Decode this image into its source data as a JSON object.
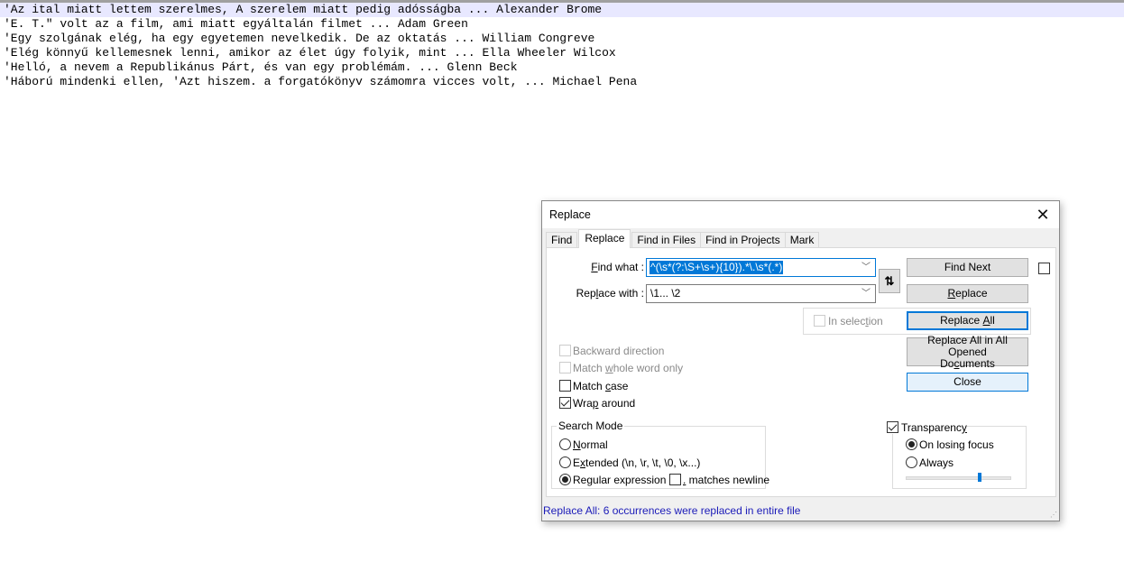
{
  "editor": {
    "lines": [
      "'Az ital miatt lettem szerelmes, A szerelem miatt pedig adósságba ... Alexander Brome",
      "'E. T.\" volt az a film, ami miatt egyáltalán filmet ... Adam Green",
      "'Egy szolgának elég, ha egy egyetemen nevelkedik. De az oktatás ... William Congreve",
      "'Elég könnyű kellemesnek lenni, amikor az élet úgy folyik, mint ... Ella Wheeler Wilcox",
      "'Helló, a nevem a Republikánus Párt, és van egy problémám. ... Glenn Beck",
      "'Háború mindenki ellen, 'Azt hiszem. a forgatókönyv számomra vicces volt, ... Michael Pena"
    ],
    "current_line_color": "#e8e8ff"
  },
  "dialog": {
    "title": "Replace",
    "close_icon": "close-icon",
    "tabs": [
      {
        "label": "Find",
        "active": false
      },
      {
        "label": "Replace",
        "active": true
      },
      {
        "label": "Find in Files",
        "active": false
      },
      {
        "label": "Find in Projects",
        "active": false
      },
      {
        "label": "Mark",
        "active": false
      }
    ],
    "find_what": {
      "label_pre": "",
      "label_u": "F",
      "label_post": "ind what :",
      "value": "^(\\s*(?:\\S+\\s+){10}).*\\.\\s*(.*)"
    },
    "replace_with": {
      "label_pre": "Rep",
      "label_u": "l",
      "label_post": "ace with :",
      "value": "\\1... \\2"
    },
    "swap_icon": "swap-arrows-icon",
    "swap_glyph": "⇅",
    "buttons": {
      "find_next": "Find Next",
      "replace_pre": "",
      "replace_u": "R",
      "replace_post": "eplace",
      "replace_all_pre": "Replace ",
      "replace_all_u": "A",
      "replace_all_post": "ll",
      "replace_all_opened_line1": "Replace All in All Opened",
      "replace_all_opened_pre": "Do",
      "replace_all_opened_u": "c",
      "replace_all_opened_post": "uments",
      "close": "Close"
    },
    "in_selection": {
      "pre": "In selec",
      "u": "t",
      "post": "ion",
      "checked": false,
      "enabled": false
    },
    "options": {
      "backward": {
        "label": "Backward direction",
        "checked": false,
        "enabled": false
      },
      "whole_word": {
        "pre": "Match ",
        "u": "w",
        "post": "hole word only",
        "checked": false,
        "enabled": false
      },
      "match_case": {
        "pre": "Match ",
        "u": "c",
        "post": "ase",
        "checked": false,
        "enabled": true
      },
      "wrap_around": {
        "pre": "Wra",
        "u": "p",
        "post": " around",
        "checked": true,
        "enabled": true
      }
    },
    "search_mode": {
      "title": "Search Mode",
      "normal": {
        "pre": "",
        "u": "N",
        "post": "ormal",
        "selected": false
      },
      "extended": {
        "pre": "E",
        "u": "x",
        "post": "tended (\\n, \\r, \\t, \\0, \\x...)",
        "selected": false
      },
      "regex": {
        "pre": "Re",
        "u": "g",
        "post": "ular expression",
        "selected": true
      },
      "dot_newline": {
        "u": ".",
        "post": " matches newline",
        "checked": false
      }
    },
    "transparency": {
      "pre": "Transparenc",
      "u": "y",
      "post": "",
      "checked": true,
      "on_losing_focus": {
        "label": "On losing focus",
        "selected": true
      },
      "always": {
        "label": "Always",
        "selected": false
      },
      "level_fraction": 0.7
    },
    "status": "Replace All: 6 occurrences were replaced in entire file",
    "accent": "#0078d7"
  }
}
